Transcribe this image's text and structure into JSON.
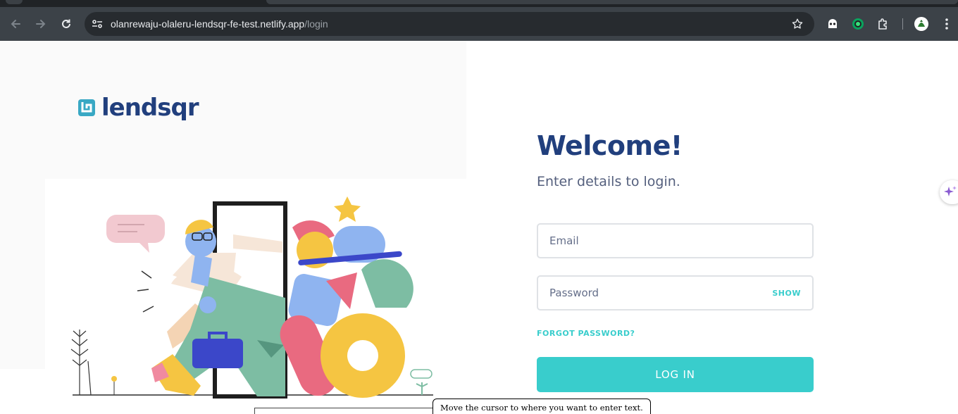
{
  "browser": {
    "url_host": "olanrewaju-olaleru-lendsqr-fe-test.netlify.app",
    "url_path": "/login",
    "icons": {
      "back": "arrow-left-icon",
      "forward": "arrow-right-icon",
      "reload": "reload-icon",
      "site_info": "tune-icon",
      "bookmark": "star-icon",
      "extensions": [
        "ghost-extension-icon",
        "green-extension-icon",
        "puzzle-icon"
      ],
      "profile": "avatar",
      "menu": "kebab-menu-icon"
    }
  },
  "brand": {
    "name": "lendsqr",
    "color": "#213f7d",
    "accent": "#39cdcc"
  },
  "login": {
    "title": "Welcome!",
    "subtitle": "Enter details to login.",
    "email_placeholder": "Email",
    "password_placeholder": "Password",
    "show_label": "SHOW",
    "forgot_label": "FORGOT PASSWORD?",
    "submit_label": "LOG IN"
  },
  "overlay": {
    "tooltip": "Move the cursor to where you want to enter text."
  }
}
